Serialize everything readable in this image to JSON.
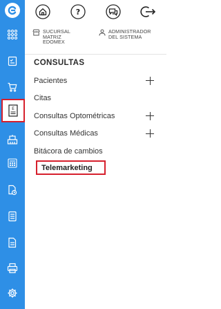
{
  "rail": {
    "items": [
      {
        "name": "logo-icon"
      },
      {
        "name": "apps-grid-icon"
      },
      {
        "name": "clipboard-check-icon"
      },
      {
        "name": "cart-icon"
      },
      {
        "name": "eye-chart-icon"
      },
      {
        "name": "building-icon"
      },
      {
        "name": "calculator-icon"
      },
      {
        "name": "document-clock-icon"
      },
      {
        "name": "document-list-icon"
      },
      {
        "name": "document-icon"
      },
      {
        "name": "printer-icon"
      },
      {
        "name": "settings-icon"
      }
    ],
    "active_index": 4,
    "colors": {
      "background": "#2e8fe6",
      "highlight": "#d61f2c"
    }
  },
  "topbar": {
    "buttons": [
      "home-icon",
      "help-icon",
      "chat-icon",
      "logout-icon"
    ]
  },
  "info": {
    "branch_lines": [
      "SUCURSAL",
      "MATRIZ",
      "EDOMEX"
    ],
    "role_lines": [
      "ADMINISTRADOR",
      "DEL SISTEMA"
    ]
  },
  "section": {
    "title": "CONSULTAS"
  },
  "menu": [
    {
      "label": "Pacientes",
      "expandable": true
    },
    {
      "label": "Citas",
      "expandable": false
    },
    {
      "label": "Consultas Optométricas",
      "expandable": true
    },
    {
      "label": "Consultas Médicas",
      "expandable": true
    },
    {
      "label": "Bitácora de cambios",
      "expandable": false
    },
    {
      "label": "Telemarketing",
      "expandable": false,
      "selected": true
    }
  ]
}
